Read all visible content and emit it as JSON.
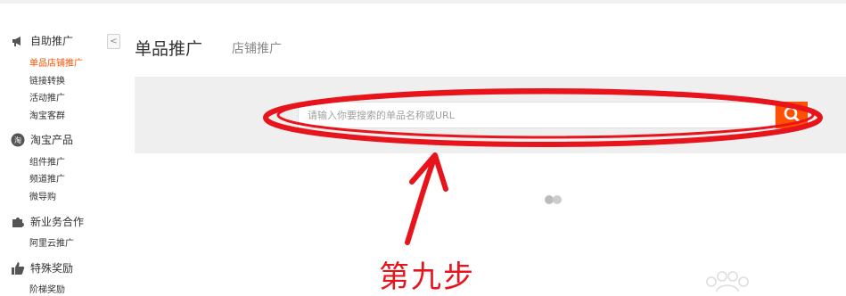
{
  "sidebar": {
    "sections": [
      {
        "icon": "megaphone-icon",
        "label": "自助推广",
        "items": [
          "单品店铺推广",
          "链接转换",
          "活动推广",
          "淘宝客群"
        ]
      },
      {
        "icon": "taobao-icon",
        "label": "淘宝产品",
        "items": [
          "组件推广",
          "频道推广",
          "微导购"
        ]
      },
      {
        "icon": "puzzle-icon",
        "label": "新业务合作",
        "items": [
          "阿里云推广"
        ]
      },
      {
        "icon": "thumbs-up-icon",
        "label": "特殊奖励",
        "items": [
          "阶梯奖励"
        ]
      }
    ],
    "active_item": "单品店铺推广",
    "collapse_glyph": "<"
  },
  "tabs": {
    "active": "单品推广",
    "inactive": "店铺推广"
  },
  "search": {
    "placeholder": "请输入你要搜索的单品名称或URL"
  },
  "annotation": {
    "step_text": "第九步",
    "color": "#e8141c"
  },
  "colors": {
    "accent": "#ff5000"
  }
}
